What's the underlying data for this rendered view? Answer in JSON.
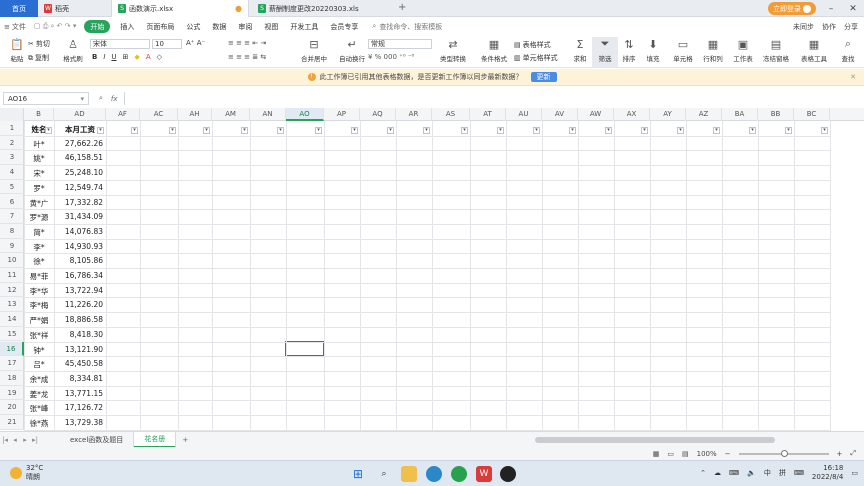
{
  "tabs": {
    "home": "首页",
    "items": [
      {
        "label": "稻壳",
        "icon_color": "#d93b3b",
        "icon_text": "W"
      },
      {
        "label": "函数演示.xlsx",
        "icon_color": "#27a35c",
        "icon_text": "S"
      },
      {
        "label": "薪酬制度更改20220303.xls",
        "icon_color": "#27a35c",
        "icon_text": "S"
      }
    ],
    "new_tab": "+",
    "login": "立即登录"
  },
  "menu": {
    "file": "文件",
    "start": "开始",
    "items": [
      "插入",
      "页面布局",
      "公式",
      "数据",
      "审阅",
      "视图",
      "开发工具",
      "会员专享"
    ],
    "search": "查找命令、搜索模板",
    "right": [
      "未同步",
      "协作",
      "分享"
    ]
  },
  "ribbon": {
    "cut": "剪切",
    "copy": "复制",
    "format_painter": "格式刷",
    "paste": "粘贴",
    "font_name": "宋体",
    "font_size": "10",
    "bold": "B",
    "italic": "I",
    "underline": "U",
    "merge": "合并居中",
    "wrap": "自动换行",
    "number_format": "常规",
    "type_convert": "类型转换",
    "cond_format": "条件格式",
    "table_style": "表格样式",
    "cell_style": "单元格样式",
    "sum": "求和",
    "filter": "筛选",
    "sort": "排序",
    "fill": "填充",
    "cell": "单元格",
    "row_col": "行和列",
    "worksheet": "工作表",
    "freeze": "冻结窗格",
    "table_tools": "表格工具",
    "find": "查找"
  },
  "notice": {
    "text": "此工作簿已引用其他表格数据，是否更新工作簿以同步最新数据？",
    "button": "更新"
  },
  "formula_bar": {
    "name_box": "AO16",
    "fx": "fx",
    "value": ""
  },
  "columns": [
    "B",
    "AD",
    "AF",
    "AC",
    "AH",
    "AM",
    "AN",
    "AO",
    "AP",
    "AQ",
    "AR",
    "AS",
    "AT",
    "AU",
    "AV",
    "AW",
    "AX",
    "AY",
    "AZ",
    "BA",
    "BB",
    "BC"
  ],
  "header_row": {
    "name": "姓名",
    "salary": "本月工资"
  },
  "rows": [
    {
      "n": "2",
      "name": "叶*",
      "salary": "27,662.26"
    },
    {
      "n": "3",
      "name": "姚*",
      "salary": "46,158.51"
    },
    {
      "n": "4",
      "name": "宋*",
      "salary": "25,248.10"
    },
    {
      "n": "5",
      "name": "罗*",
      "salary": "12,549.74"
    },
    {
      "n": "6",
      "name": "黄*广",
      "salary": "17,332.82"
    },
    {
      "n": "7",
      "name": "罗*源",
      "salary": "31,434.09"
    },
    {
      "n": "8",
      "name": "简*",
      "salary": "14,076.83"
    },
    {
      "n": "9",
      "name": "李*",
      "salary": "14,930.93"
    },
    {
      "n": "10",
      "name": "徐*",
      "salary": "8,105.86"
    },
    {
      "n": "11",
      "name": "易*菲",
      "salary": "16,786.34"
    },
    {
      "n": "12",
      "name": "李*华",
      "salary": "13,722.94"
    },
    {
      "n": "13",
      "name": "李*梅",
      "salary": "11,226.20"
    },
    {
      "n": "14",
      "name": "严*娟",
      "salary": "18,886.58"
    },
    {
      "n": "15",
      "name": "张*祥",
      "salary": "8,418.30"
    },
    {
      "n": "16",
      "name": "钟*",
      "salary": "13,121.90"
    },
    {
      "n": "17",
      "name": "吕*",
      "salary": "45,450.58"
    },
    {
      "n": "18",
      "name": "余*成",
      "salary": "8,334.81"
    },
    {
      "n": "19",
      "name": "姜*龙",
      "salary": "13,771.15"
    },
    {
      "n": "20",
      "name": "张*峰",
      "salary": "17,126.72"
    },
    {
      "n": "21",
      "name": "徐*燕",
      "salary": "13,729.38"
    }
  ],
  "sheets": {
    "items": [
      "excel函数及题目",
      "花名册"
    ],
    "active": 1,
    "add": "+"
  },
  "status": {
    "zoom": "100%",
    "minus": "−",
    "plus": "+"
  },
  "taskbar": {
    "temp": "32°C",
    "weather": "晴朗",
    "ime_lang": "中",
    "ime_mode": "拼",
    "time": "16:18",
    "date": "2022/8/4"
  }
}
